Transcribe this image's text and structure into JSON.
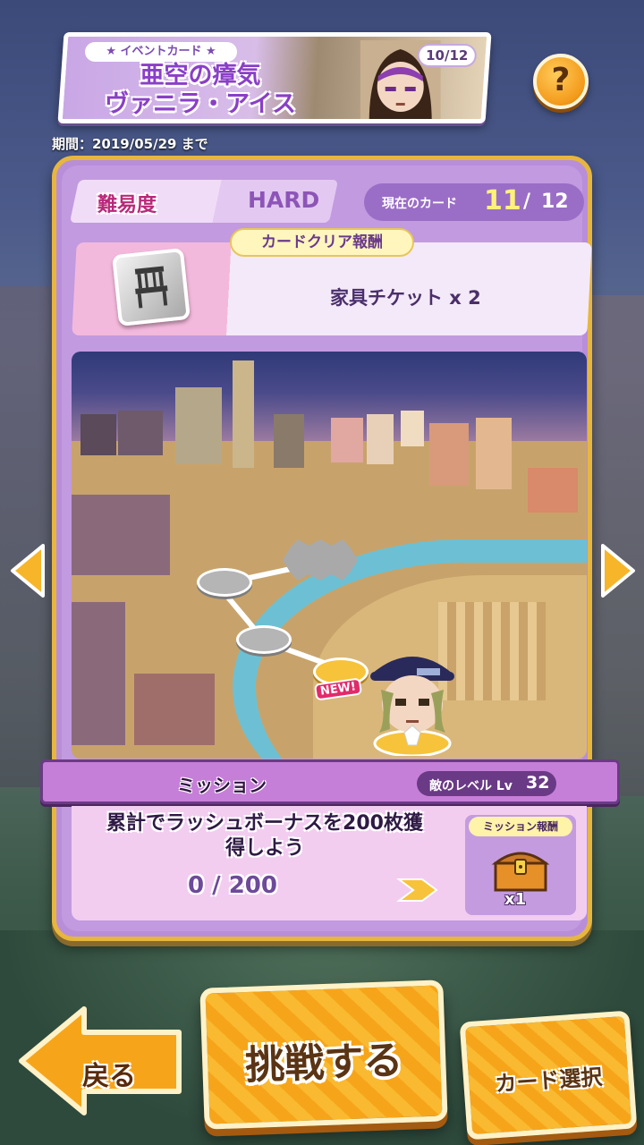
{
  "event": {
    "tag": "★ イベントカード ★",
    "title_line1": "亜空の瘴気",
    "title_line2": "ヴァニラ・アイス",
    "counter": "10/12",
    "period": "期間：2019/05/29 まで"
  },
  "help": {
    "label": "?"
  },
  "difficulty": {
    "label": "難易度",
    "value": "HARD"
  },
  "card_status": {
    "label": "現在のカード",
    "current": "11",
    "separator": "/",
    "total": "12"
  },
  "card_reward": {
    "tag": "カードクリア報酬",
    "text": "家具チケット x 2"
  },
  "map": {
    "new_badge": "NEW!"
  },
  "mission": {
    "title": "ミッション",
    "enemy_level_label": "敵のレベル Lv",
    "enemy_level_value": "32",
    "description_line1": "累計でラッシュボーナスを200枚獲",
    "description_line2": "得しよう",
    "progress": "0 / 200",
    "reward_label": "ミッション報酬",
    "reward_count": "x1"
  },
  "buttons": {
    "back": "戻る",
    "challenge": "挑戦する",
    "card_select": "カード選択"
  },
  "icons": {
    "reward_icon": "chair-icon",
    "mission_reward_icon": "treasure-chest-icon",
    "prev": "chevron-left-icon",
    "next": "chevron-right-icon"
  },
  "colors": {
    "panel": "#c19ae0",
    "panel_border": "#e7b63f",
    "accent_yellow": "#fff27a",
    "button_orange": "#f6a51a"
  }
}
